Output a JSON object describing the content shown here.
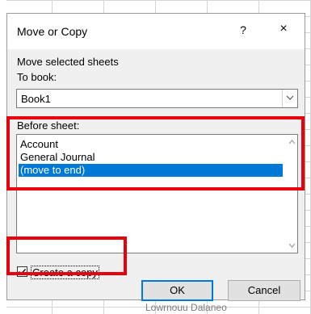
{
  "dialog": {
    "title": "Move or Copy",
    "help_label": "?",
    "close_label": "×",
    "move_selected_label": "Move selected sheets",
    "to_book_label": "To book:",
    "to_book_value": "Book1",
    "before_sheet_label": "Before sheet:",
    "sheets": [
      "Account",
      "General Journal",
      "(move to end)"
    ],
    "selected_sheet_index": 2,
    "create_copy_label": "Create a copy",
    "create_copy_checked": true,
    "ok_label": "OK",
    "cancel_label": "Cancel"
  },
  "background": {
    "partial_text": "Lowrnouu Dalaneo"
  },
  "colors": {
    "highlight": "#e8000c",
    "selection": "#0078d7"
  },
  "icons": {
    "dropdown": "chevron-down-icon",
    "close": "close-icon",
    "help": "help-icon",
    "checkmark": "checkmark-icon"
  }
}
